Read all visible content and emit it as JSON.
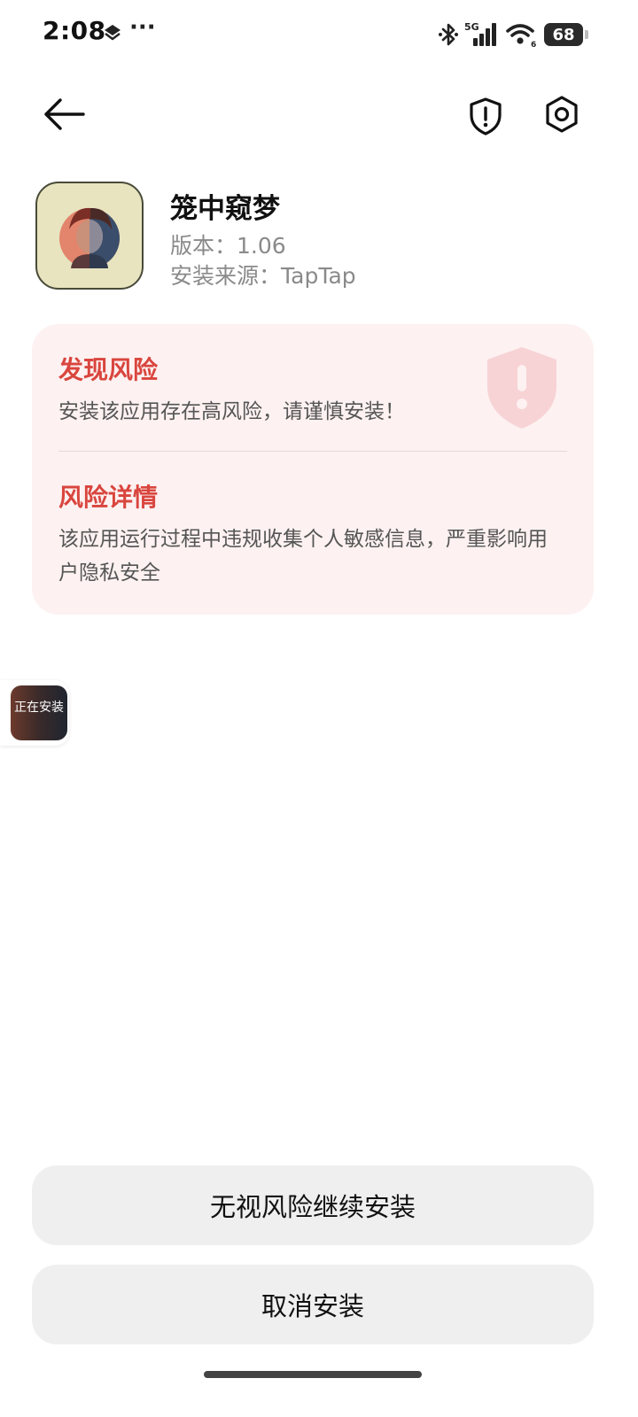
{
  "status_bar": {
    "time": "2:08",
    "more": "···",
    "network": "5G",
    "battery": "68"
  },
  "header": {
    "back_icon": "arrow-left-icon",
    "shield_icon": "shield-exclamation-icon",
    "settings_icon": "hexagon-gear-icon"
  },
  "app": {
    "name": "笼中窥梦",
    "version": "版本：1.06",
    "source": "安装来源：TapTap"
  },
  "risk": {
    "found_title": "发现风险",
    "found_text": "安装该应用存在高风险，请谨慎安装！",
    "details_title": "风险详情",
    "details_text": "该应用运行过程中违规收集个人敏感信息，严重影响用户隐私安全",
    "accent_color": "#d9463e",
    "card_color": "#fdf1f1"
  },
  "floating": {
    "label": "正在安装"
  },
  "actions": {
    "continue_label": "无视风险继续安装",
    "cancel_label": "取消安装"
  }
}
